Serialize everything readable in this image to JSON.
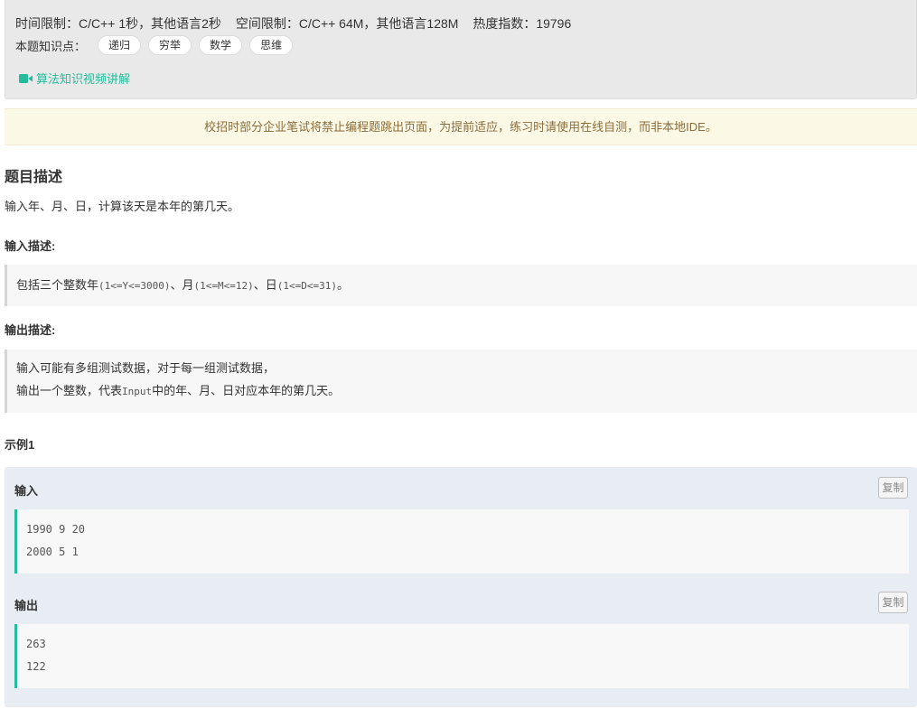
{
  "limits": {
    "time": "时间限制：C/C++ 1秒，其他语言2秒",
    "space": "空间限制：C/C++ 64M，其他语言128M",
    "heat": "热度指数：19796"
  },
  "tags": {
    "label": "本题知识点：",
    "items": [
      "递归",
      "穷举",
      "数学",
      "思维"
    ]
  },
  "video_link": {
    "label": "算法知识视频讲解",
    "icon": "video-camera-icon"
  },
  "notice": "校招时部分企业笔试将禁止编程题跳出页面，为提前适应，练习时请使用在线自测，而非本地IDE。",
  "description": {
    "title": "题目描述",
    "text": "输入年、月、日，计算该天是本年的第几天。"
  },
  "input_desc": {
    "title": "输入描述:",
    "prefix": "包括三个整数年",
    "y_range": "(1<=Y<=3000)",
    "sep1": "、月",
    "m_range": "(1<=M<=12)",
    "sep2": "、日",
    "d_range": "(1<=D<=31)",
    "suffix": "。"
  },
  "output_desc": {
    "title": "输出描述:",
    "line1": "输入可能有多组测试数据，对于每一组测试数据，",
    "line2_prefix": "输出一个整数，代表",
    "line2_code": "Input",
    "line2_suffix": "中的年、月、日对应本年的第几天。"
  },
  "example": {
    "title": "示例1",
    "input_label": "输入",
    "output_label": "输出",
    "copy_label": "复制",
    "input_lines": [
      "1990 9 20",
      "2000 5 1"
    ],
    "output_lines": [
      "263",
      "122"
    ]
  },
  "colors": {
    "accent": "#25bb9b",
    "notice_bg": "#fcf8e6",
    "notice_text": "#8a6d3b",
    "example_bg": "#e8edf4"
  }
}
